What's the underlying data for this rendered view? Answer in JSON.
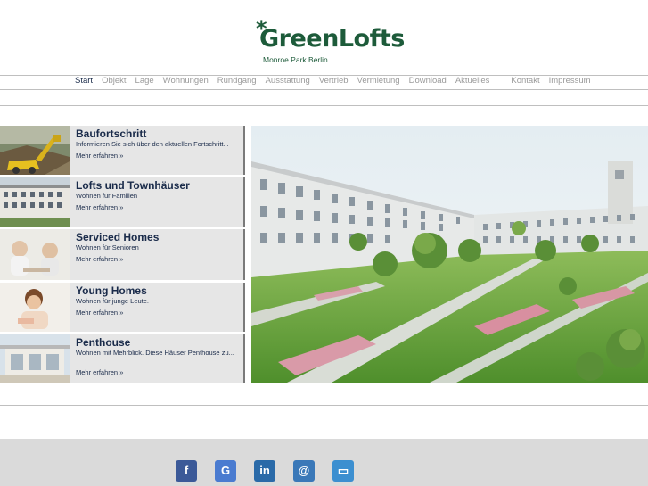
{
  "logo": {
    "brand": "GreenLofts",
    "tagline": "Monroe Park Berlin",
    "asterisk": "*"
  },
  "nav": {
    "items": [
      "Start",
      "Objekt",
      "Lage",
      "Wohnungen",
      "Rundgang",
      "Ausstattung",
      "Vertrieb",
      "Vermietung",
      "Download",
      "Aktuelles"
    ],
    "items_right": [
      "Kontakt",
      "Impressum"
    ],
    "active": "Start"
  },
  "list": [
    {
      "title": "Baufortschritt",
      "desc": "Informieren Sie sich über den aktuellen Fortschritt...",
      "more": "Mehr erfahren »"
    },
    {
      "title": "Lofts und Townhäuser",
      "desc": "Wohnen für Familien",
      "more": "Mehr erfahren »"
    },
    {
      "title": "Serviced Homes",
      "desc": "Wohnen für Senioren",
      "more": "Mehr erfahren »"
    },
    {
      "title": "Young Homes",
      "desc": "Wohnen für junge Leute.",
      "more": "Mehr erfahren »"
    },
    {
      "title": "Penthouse",
      "desc": "Wohnen mit Mehrblick. Diese Häuser Penthouse zu...",
      "more": "Mehr erfahren »"
    }
  ],
  "footer": {
    "social": [
      {
        "icon": "facebook-icon",
        "glyph": "f",
        "color": "#3b5998"
      },
      {
        "icon": "google-icon",
        "glyph": "G",
        "color": "#4a7bd0"
      },
      {
        "icon": "linkedin-icon",
        "glyph": "in",
        "color": "#2a6aa8"
      },
      {
        "icon": "email-icon",
        "glyph": "@",
        "color": "#3a78b8"
      },
      {
        "icon": "folder-icon",
        "glyph": "▭",
        "color": "#3c8fd0"
      }
    ]
  },
  "colors": {
    "brand_green": "#1d5b3a",
    "navy": "#1a2b4a",
    "panel_gray": "#e6e6e6"
  }
}
